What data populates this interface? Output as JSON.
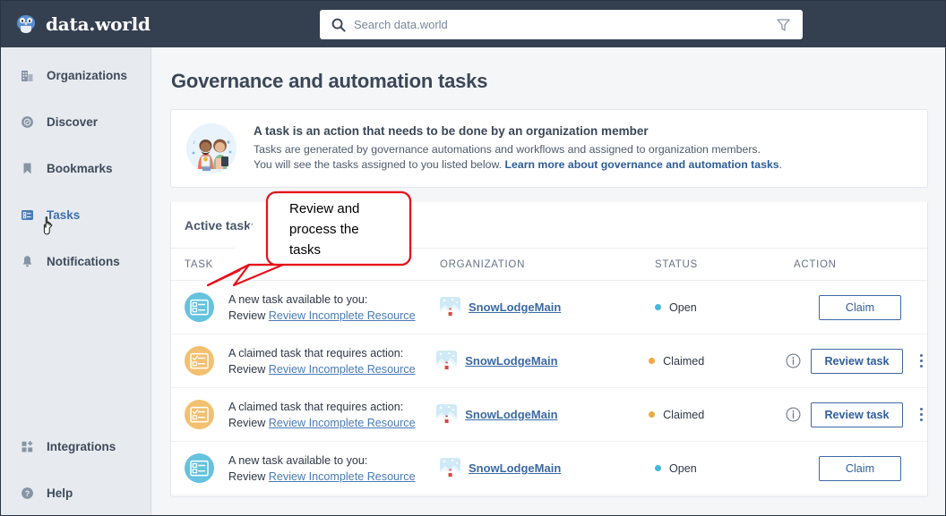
{
  "topbar": {
    "brand_name": "data.world",
    "logo_icon": "owl-logo-icon",
    "search_placeholder": "Search data.world",
    "search_value": "",
    "search_icon": "search-icon",
    "filter_icon": "filter-funnel-icon"
  },
  "sidebar": {
    "items": [
      {
        "label": "Organizations",
        "icon": "building-icon",
        "active": false
      },
      {
        "label": "Discover",
        "icon": "compass-icon",
        "active": false
      },
      {
        "label": "Bookmarks",
        "icon": "bookmark-icon",
        "active": false
      },
      {
        "label": "Tasks",
        "icon": "tasks-list-icon",
        "active": true
      },
      {
        "label": "Notifications",
        "icon": "bell-icon",
        "active": false
      }
    ],
    "bottom_items": [
      {
        "label": "Integrations",
        "icon": "grid-plus-icon"
      },
      {
        "label": "Help",
        "icon": "question-circle-icon"
      }
    ]
  },
  "main": {
    "page_title": "Governance and automation tasks",
    "banner": {
      "illustration": "two-people-illustration",
      "heading": "A task is an action that needs to be done by an organization member",
      "line1": "Tasks are generated by governance automations and workflows and assigned to organization members.",
      "line2_prefix": "You will see the tasks assigned to you listed below. ",
      "link_text": "Learn more about governance and automation tasks",
      "line2_suffix": "."
    },
    "table": {
      "section_title": "Active tasks",
      "headers": [
        "TASK",
        "ORGANIZATION",
        "STATUS",
        "ACTION"
      ],
      "rows": [
        {
          "icon": "task-new-icon",
          "icon_color": "#64c3de",
          "task_line1": "A new task available to you:",
          "task_prefix": "Review ",
          "task_link": "Review Incomplete Resource",
          "org_avatar": "snow-lodge-avatar",
          "org_name": "SnowLodgeMain",
          "status": "Open",
          "status_color": "#45b7d9",
          "has_info": false,
          "action_label": "Claim",
          "action_bold": false,
          "has_kebab": false
        },
        {
          "icon": "task-claimed-icon",
          "icon_color": "#f3c070",
          "task_line1": "A claimed task that requires action:",
          "task_prefix": "Review ",
          "task_link": "Review Incomplete Resource",
          "org_avatar": "snow-lodge-avatar",
          "org_name": "SnowLodgeMain",
          "status": "Claimed",
          "status_color": "#f0a940",
          "has_info": true,
          "action_label": "Review task",
          "action_bold": true,
          "has_kebab": true
        },
        {
          "icon": "task-claimed-icon",
          "icon_color": "#f3c070",
          "task_line1": "A claimed task that requires action:",
          "task_prefix": "Review ",
          "task_link": "Review Incomplete Resource",
          "org_avatar": "snow-lodge-avatar",
          "org_name": "SnowLodgeMain",
          "status": "Claimed",
          "status_color": "#f0a940",
          "has_info": true,
          "action_label": "Review task",
          "action_bold": true,
          "has_kebab": true
        },
        {
          "icon": "task-new-icon",
          "icon_color": "#64c3de",
          "task_line1": "A new task available to you:",
          "task_prefix": "Review ",
          "task_link": "Review Incomplete Resource",
          "org_avatar": "snow-lodge-avatar",
          "org_name": "SnowLodgeMain",
          "status": "Open",
          "status_color": "#45b7d9",
          "has_info": false,
          "action_label": "Claim",
          "action_bold": false,
          "has_kebab": false
        }
      ]
    }
  },
  "annotation": {
    "text_line1": "Review and",
    "text_line2": "process the",
    "text_line3": "tasks",
    "color": "#e8101a"
  },
  "colors": {
    "topbar_bg": "#343f50",
    "sidebar_bg": "#e7ebf0",
    "page_bg": "#f4f6f8",
    "link_blue": "#3c6aa5",
    "active_blue": "#3e6fae"
  }
}
